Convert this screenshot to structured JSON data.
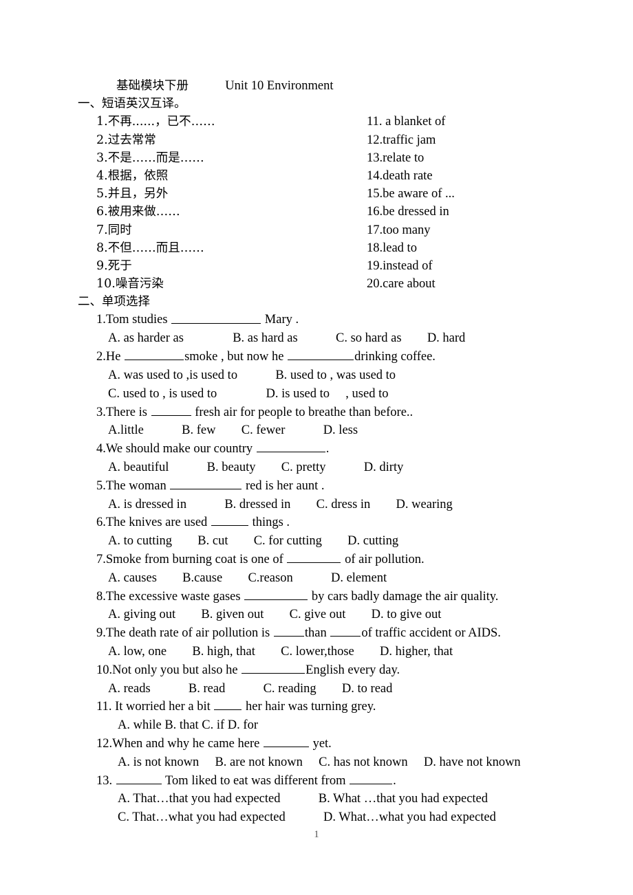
{
  "document": {
    "title_cn": "基础模块下册",
    "title_en": "Unit 10 Environment",
    "page_number": "1"
  },
  "section1": {
    "heading": "一、短语英汉互译。",
    "items_left": [
      "1.不再......，已不……",
      "2.过去常常",
      "3.不是……而是……",
      "4.根据，依照",
      "5.并且，另外",
      "6.被用来做……",
      "7.同时",
      "8.不但……而且……",
      "9.死于",
      "10.噪音污染"
    ],
    "items_right": [
      "11. a blanket of",
      "12.traffic jam",
      "13.relate to",
      "14.death rate",
      "15.be aware of ...",
      "16.be dressed in",
      "17.too many",
      "18.lead to",
      "19.instead of",
      "20.care about"
    ]
  },
  "section2": {
    "heading": "二、单项选择",
    "questions": [
      {
        "stem_before": "1.Tom studies",
        "stem_after": "Mary .",
        "options_line1": "A. as harder as",
        "options_line2": "B. as hard as",
        "options_line3": "C. so hard as",
        "options_line4": "D. hard"
      },
      {
        "stem_before": "2.He",
        "stem_mid": "smoke , but now he",
        "stem_after": "drinking coffee.",
        "optA": "A. was used to ,is used to",
        "optB": "B. used to , was used to",
        "optC": "C. used to , is used to",
        "optD": "D. is used to",
        "optD_tail": ", used to"
      },
      {
        "stem_before": "3.There is",
        "stem_after": "fresh air for people to breathe than before..",
        "optA": "A.little",
        "optB": "B. few",
        "optC": "C. fewer",
        "optD": "D. less"
      },
      {
        "stem_before": "4.We should make our country",
        "stem_after": ".",
        "optA": "A. beautiful",
        "optB": "B. beauty",
        "optC": "C. pretty",
        "optD": "D. dirty"
      },
      {
        "stem_before": "5.The woman",
        "stem_after": "red is her aunt .",
        "optA": "A. is dressed in",
        "optB": "B. dressed in",
        "optC": "C. dress in",
        "optD": "D. wearing"
      },
      {
        "stem_before": "6.The knives are used",
        "stem_after": "things .",
        "optA": "A. to cutting",
        "optB": "B. cut",
        "optC": "C. for cutting",
        "optD": "D. cutting"
      },
      {
        "stem_before": "7.Smoke from burning coat is one of",
        "stem_after": "of air pollution.",
        "optA": "A. causes",
        "optB": "B.cause",
        "optC": "C.reason",
        "optD": "D. element"
      },
      {
        "stem_before": "8.The excessive waste gases",
        "stem_after": "by cars badly damage the air quality.",
        "optA": "A. giving out",
        "optB": "B. given out",
        "optC": "C. give out",
        "optD": "D. to give out"
      },
      {
        "stem_before": "9.The death rate of air pollution is",
        "stem_mid": "than",
        "stem_after": "of traffic accident or AIDS.",
        "optA": "A. low, one",
        "optB": "B. high, that",
        "optC": "C. lower,those",
        "optD": "D. higher, that"
      },
      {
        "stem_before": "10.Not only you but also he",
        "stem_after": "English every day.",
        "optA": "A. reads",
        "optB": "B. read",
        "optC": "C. reading",
        "optD": "D. to read"
      },
      {
        "stem_before": "11. It worried her a bit",
        "stem_after": "her hair was turning grey.",
        "options_inline": "A. while B. that C. if D. for"
      },
      {
        "stem_before": "12.When and why he came here",
        "stem_after": "yet.",
        "optA": "A. is not known",
        "optB": "B. are not known",
        "optC": "C. has not known",
        "optD": "D. have not known"
      },
      {
        "stem_before": "13.",
        "stem_mid": "Tom liked to eat was different from",
        "stem_after": ".",
        "optA": "A. That…that you had expected",
        "optB": "B. What …that you had expected",
        "optC": "C. That…what you had expected",
        "optD": "D. What…what you had expected"
      }
    ]
  }
}
